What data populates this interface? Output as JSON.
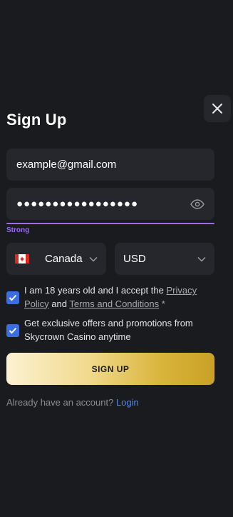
{
  "modal": {
    "title": "Sign Up",
    "email_value": "example@gmail.com",
    "password_mask": "●●●●●●●●●●●●●●●●●",
    "strength_label": "Strong",
    "country": "Canada",
    "currency": "USD",
    "consent_prefix": "I am 18 years old and I accept the ",
    "privacy_policy_link": "Privacy Policy",
    "consent_and": " and ",
    "terms_link": "Terms and Conditions",
    "required_marker": " *",
    "promo_text": "Get exclusive offers and promotions from Skycrown Casino anytime",
    "signup_label": "SIGN UP",
    "login_prompt": "Already have an account? ",
    "login_link": "Login"
  },
  "icons": {
    "close": "close-icon",
    "eye": "eye-icon",
    "flag": "canada-flag-icon",
    "chevron": "chevron-down-icon",
    "check": "check-icon"
  },
  "colors": {
    "background": "#1a1b1e",
    "field": "#26272c",
    "accent_purple": "#9c6cf0",
    "checkbox_blue": "#3b6de3",
    "link_blue": "#4c86f0",
    "gold_start": "#fbf2d2",
    "gold_end": "#c9a126"
  }
}
